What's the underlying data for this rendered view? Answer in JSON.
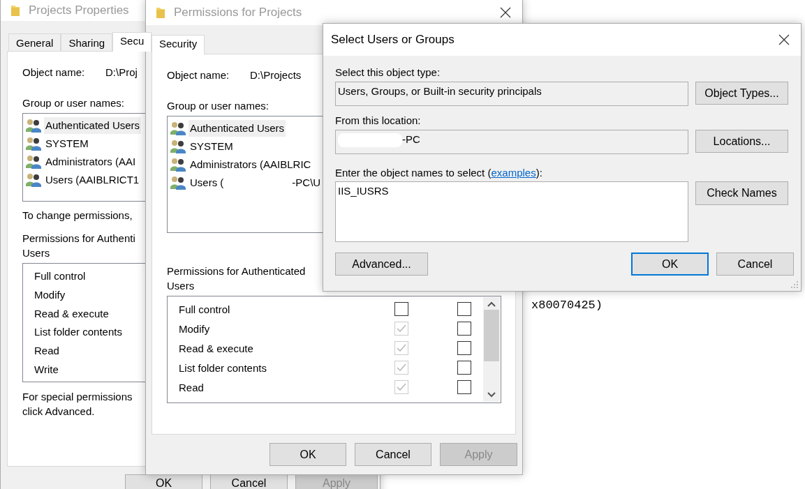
{
  "console": {
    "text": "x80070425)"
  },
  "properties_window": {
    "title": "Projects Properties",
    "tabs": [
      {
        "label": "General",
        "selected": false
      },
      {
        "label": "Sharing",
        "selected": false
      },
      {
        "label": "Secu",
        "selected": true
      }
    ],
    "object_name_label": "Object name:",
    "object_name": "D:\\Proj",
    "group_label": "Group or user names:",
    "users": [
      {
        "name": "Authenticated Users",
        "selected": true
      },
      {
        "name": "SYSTEM",
        "selected": false
      },
      {
        "name": "Administrators (AAI",
        "selected": false
      },
      {
        "name": "Users (AAIBLRICT1",
        "selected": false
      }
    ],
    "change_hint": "To change permissions,",
    "permissions_label": [
      "Permissions for Authenti",
      "Users"
    ],
    "permissions": [
      "Full control",
      "Modify",
      "Read & execute",
      "List folder contents",
      "Read",
      "Write"
    ],
    "special_hint": [
      "For special permissions",
      "click Advanced."
    ],
    "buttons": [
      {
        "label": "OK",
        "disabled": false
      },
      {
        "label": "Cancel",
        "disabled": false
      },
      {
        "label": "Apply",
        "disabled": true
      }
    ]
  },
  "permissions_window": {
    "title": "Permissions for Projects",
    "tabs": [
      {
        "label": "Security",
        "selected": true
      }
    ],
    "object_name_label": "Object name:",
    "object_name": "D:\\Projects",
    "group_label": "Group or user names:",
    "users": [
      {
        "name": "Authenticated Users",
        "selected": true
      },
      {
        "name": "SYSTEM",
        "selected": false
      },
      {
        "name": "Administrators (AAIBLRIC",
        "selected": false
      },
      {
        "name": "Users (",
        "name_tail": "-PC\\U",
        "selected": false
      }
    ],
    "permissions_label": "Permissions for Authenticated Users",
    "permissions": [
      {
        "name": "Full control",
        "allow_checked": false,
        "allow_disabled": false,
        "deny_checked": false
      },
      {
        "name": "Modify",
        "allow_checked": true,
        "allow_disabled": true,
        "deny_checked": false
      },
      {
        "name": "Read & execute",
        "allow_checked": true,
        "allow_disabled": true,
        "deny_checked": false
      },
      {
        "name": "List folder contents",
        "allow_checked": true,
        "allow_disabled": true,
        "deny_checked": false
      },
      {
        "name": "Read",
        "allow_checked": true,
        "allow_disabled": true,
        "deny_checked": false
      }
    ],
    "buttons": [
      {
        "label": "OK",
        "disabled": false
      },
      {
        "label": "Cancel",
        "disabled": false
      },
      {
        "label": "Apply",
        "disabled": true
      }
    ]
  },
  "select_dialog": {
    "title": "Select Users or Groups",
    "object_type_label": "Select this object type:",
    "object_type": "Users, Groups, or Built-in security principals",
    "object_types_button": "Object Types...",
    "location_label": "From this location:",
    "location": "-PC",
    "locations_button": "Locations...",
    "names_label_before": "Enter the object names to select (",
    "names_link": "examples",
    "names_label_after": "):",
    "names_value": "IIS_IUSRS",
    "check_names_button": "Check Names",
    "advanced_button": "Advanced...",
    "buttons": [
      {
        "label": "OK",
        "default": true
      },
      {
        "label": "Cancel",
        "default": false
      }
    ]
  }
}
